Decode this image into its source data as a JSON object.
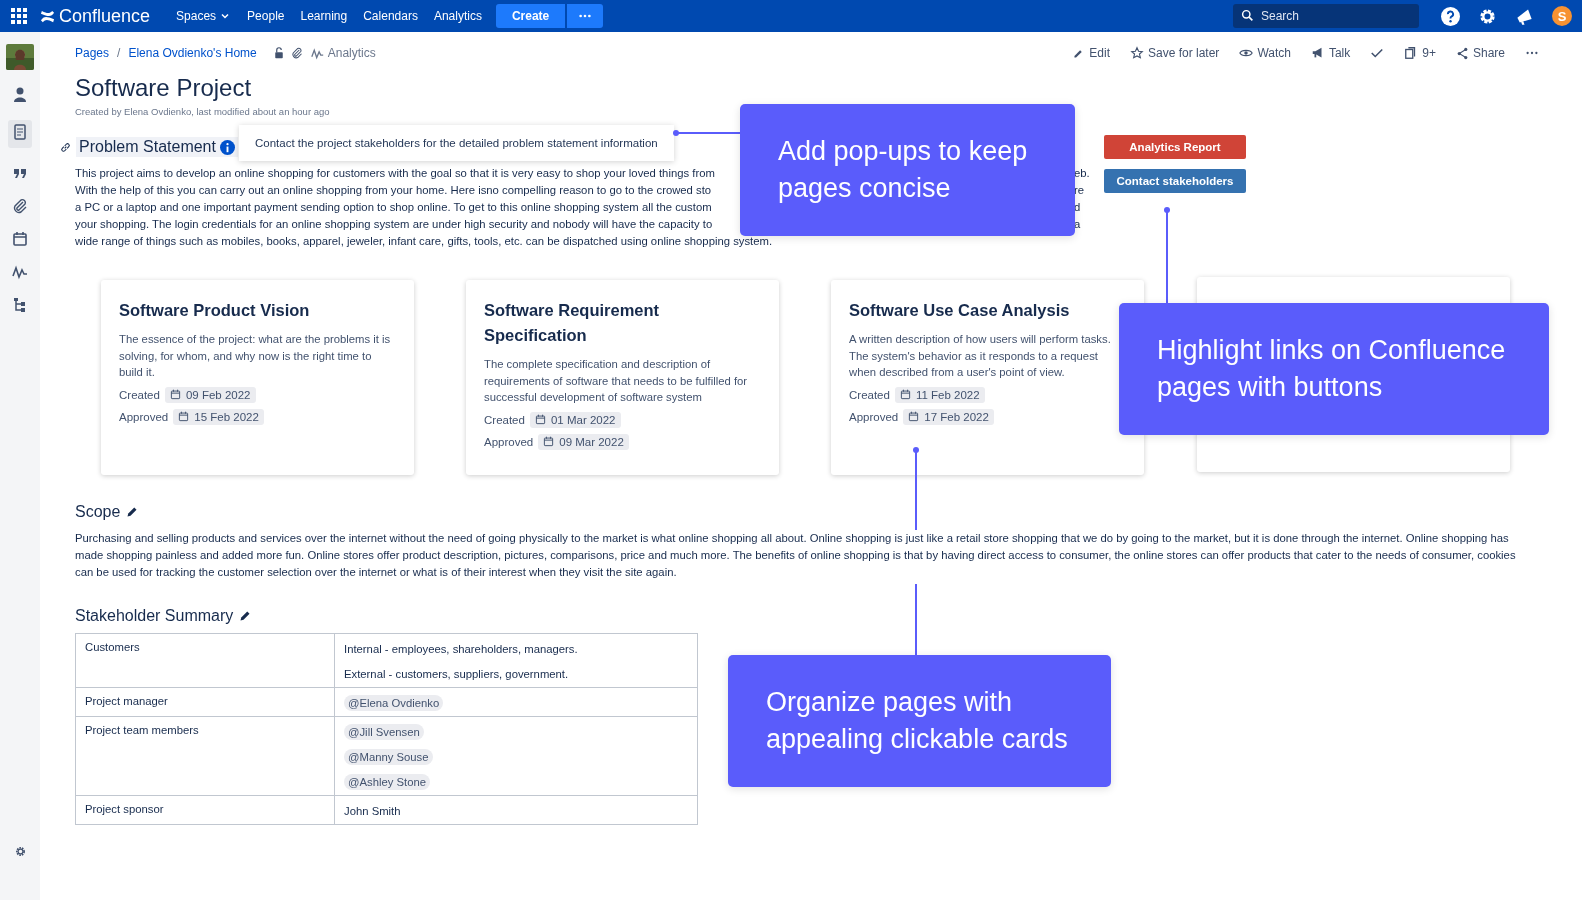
{
  "topnav": {
    "logo": "Confluence",
    "items": [
      {
        "label": "Spaces",
        "dropdown": true
      },
      {
        "label": "People",
        "dropdown": false
      },
      {
        "label": "Learning",
        "dropdown": false
      },
      {
        "label": "Calendars",
        "dropdown": false
      },
      {
        "label": "Analytics",
        "dropdown": false
      }
    ],
    "create": "Create",
    "search": {
      "placeholder": "Search"
    },
    "avatar": "S"
  },
  "breadcrumbs": [
    "Pages",
    "Elena Ovdienko's Home"
  ],
  "breadcrumb_separator": "/",
  "analytics_link": "Analytics",
  "page_actions": [
    {
      "kind": "edit",
      "label": "Edit"
    },
    {
      "kind": "star",
      "label": "Save for later"
    },
    {
      "kind": "eye",
      "label": "Watch"
    },
    {
      "kind": "megaphone",
      "label": "Talk"
    },
    {
      "kind": "check"
    },
    {
      "kind": "pages",
      "label": "9+"
    },
    {
      "kind": "share",
      "label": "Share"
    },
    {
      "kind": "more"
    }
  ],
  "title": "Software Project",
  "byline": "Created by Elena Ovdienko, last modified about an hour ago",
  "problem_statement": {
    "heading": "Problem Statement",
    "tooltip": "Contact the project stakeholders for the detailed problem statement information",
    "lines": [
      {
        "text": "This project aims to develop an online shopping for customers with the goal so that it is very easy to shop your loved things from",
        "tail": "eb."
      },
      {
        "text": "With the help of this you can carry out an online shopping from your home. Here isno compelling reason to go to the crowed sto",
        "tail": "re"
      },
      {
        "text": "a PC or a laptop and one important payment sending option to shop online. To get to this online shopping system all the custom",
        "tail": "d"
      },
      {
        "text": "your shopping. The login credentials for an online shopping system are under high security and nobody will have the capacity to",
        "tail": "a"
      },
      {
        "text": "wide range of things such as mobiles, books, apparel, jeweler, infant care, gifts, tools, etc. can be dispatched using online shopping system."
      }
    ]
  },
  "buttons": [
    {
      "label": "Analytics Report",
      "color": "#d04437"
    },
    {
      "label": "Contact stakeholders",
      "color": "#3572b0"
    }
  ],
  "cards": [
    {
      "title": "Software Product Vision",
      "description": "The essence of the project: what are the problems it is solving, for whom, and why now is the right time to build it.",
      "dates": [
        {
          "label": "Created",
          "date": "09 Feb 2022"
        },
        {
          "label": "Approved",
          "date": "15 Feb 2022"
        }
      ]
    },
    {
      "title": "Software Requirement Specification",
      "description": "The complete specification and description of requirements of software that needs to be fulfilled for successful development of software system",
      "dates": [
        {
          "label": "Created",
          "date": "01 Mar 2022"
        },
        {
          "label": "Approved",
          "date": "09 Mar 2022"
        }
      ]
    },
    {
      "title": "Software Use Case Analysis",
      "description": "A written description of how users will perform tasks. The system's behavior as it responds to a request when described from a user's point of view.",
      "dates": [
        {
          "label": "Created",
          "date": "11 Feb 2022"
        },
        {
          "label": "Approved",
          "date": "17 Feb 2022"
        }
      ]
    }
  ],
  "scope": {
    "heading": "Scope",
    "text": "Purchasing and selling products and services over the internet without the need of going physically to the market is what online shopping all about. Online shopping is just like a retail store shopping that we do by going to the market, but it is done through the internet. Online shopping has made shopping painless and added more fun. Online stores offer product description, pictures, comparisons, price and much more. The benefits of online shopping is that by having direct access to consumer, the online stores can offer products that cater to the needs of consumer, cookies can be used for tracking the customer selection over the internet or what is of their interest when they visit the site again."
  },
  "stakeholders": {
    "heading": "Stakeholder Summary",
    "rows": [
      {
        "role": "Customers",
        "values": [
          {
            "kind": "text",
            "text": "Internal - employees, shareholders, managers."
          },
          {
            "kind": "text",
            "text": "External - customers, suppliers, government."
          }
        ]
      },
      {
        "role": "Project manager",
        "values": [
          {
            "kind": "mention",
            "text": "@Elena Ovdienko"
          }
        ]
      },
      {
        "role": "Project team members",
        "values": [
          {
            "kind": "mention",
            "text": "@Jill Svensen"
          },
          {
            "kind": "mention",
            "text": "@Manny Souse"
          },
          {
            "kind": "mention",
            "text": "@Ashley Stone"
          }
        ]
      },
      {
        "role": "Project sponsor",
        "values": [
          {
            "kind": "text",
            "text": "John Smith"
          }
        ]
      }
    ]
  },
  "callouts": [
    {
      "lines": [
        "Add pop-ups to keep",
        "pages concise"
      ]
    },
    {
      "lines": [
        "Highlight links on Confluence",
        "pages with buttons"
      ]
    },
    {
      "lines": [
        "Organize pages with",
        "appealing clickable cards"
      ]
    }
  ]
}
